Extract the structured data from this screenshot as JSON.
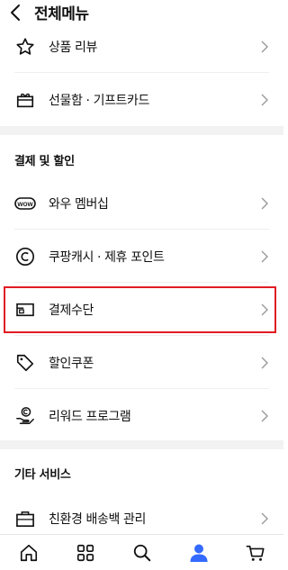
{
  "header": {
    "title": "전체메뉴"
  },
  "menu_top": [
    {
      "label": "상품 리뷰",
      "icon": "star-outline-icon"
    },
    {
      "label": "선물함 · 기프트카드",
      "icon": "gift-box-icon"
    }
  ],
  "section_payment": {
    "title": "결제 및 할인",
    "items": [
      {
        "label": "와우 멤버십",
        "icon": "wow-badge-icon"
      },
      {
        "label": "쿠팡캐시 · 제휴 포인트",
        "icon": "coupang-cash-icon"
      },
      {
        "label": "결제수단",
        "icon": "payment-card-icon"
      },
      {
        "label": "할인쿠폰",
        "icon": "coupon-tag-icon"
      },
      {
        "label": "리워드 프로그램",
        "icon": "reward-hand-icon"
      }
    ]
  },
  "section_other": {
    "title": "기타 서비스",
    "items": [
      {
        "label": "친환경 배송백 관리",
        "icon": "delivery-bag-icon"
      }
    ]
  },
  "bottom_nav": [
    {
      "name": "home",
      "icon": "home-icon",
      "active": false
    },
    {
      "name": "category",
      "icon": "category-grid-icon",
      "active": false
    },
    {
      "name": "search",
      "icon": "search-icon",
      "active": false
    },
    {
      "name": "my",
      "icon": "person-icon",
      "active": true
    },
    {
      "name": "cart",
      "icon": "cart-icon",
      "active": false
    }
  ],
  "colors": {
    "accent_blue": "#346aff",
    "highlight_red": "#e01c24",
    "divider": "#eeeeee",
    "section_gap": "#f2f2f2"
  }
}
